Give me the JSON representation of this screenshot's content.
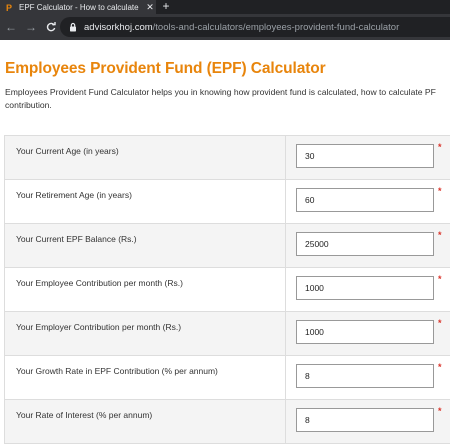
{
  "browser": {
    "tab_title": "EPF Calculator - How to calculate",
    "close_glyph": "✕",
    "new_tab_glyph": "+",
    "back_glyph": "←",
    "forward_glyph": "→",
    "reload_glyph": "C",
    "url_host": "advisorkhoj.com",
    "url_path": "/tools-and-calculators/employees-provident-fund-calculator",
    "favicon_color": "#e8850c"
  },
  "page": {
    "title": "Employees Provident Fund (EPF) Calculator",
    "intro": "Employees Provident Fund Calculator helps you in knowing how provident fund is calculated, how to calculate PF contribution.",
    "accent_color": "#e8850c",
    "required_marker": "*"
  },
  "form": {
    "fields": [
      {
        "label": "Your Current Age (in years)",
        "value": "30"
      },
      {
        "label": "Your Retirement Age (in years)",
        "value": "60"
      },
      {
        "label": "Your Current EPF Balance (Rs.)",
        "value": "25000"
      },
      {
        "label": "Your Employee Contribution per month (Rs.)",
        "value": "1000"
      },
      {
        "label": "Your Employer Contribution per month (Rs.)",
        "value": "1000"
      },
      {
        "label": "Your Growth Rate in EPF Contribution (% per annum)",
        "value": "8"
      },
      {
        "label": "Your Rate of Interest (% per annum)",
        "value": "8"
      }
    ]
  }
}
